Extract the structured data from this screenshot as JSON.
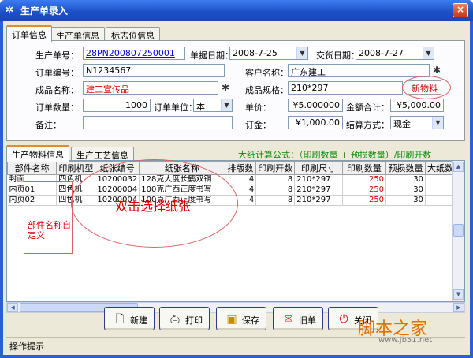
{
  "window": {
    "title": "生产单录入",
    "close_glyph": "×"
  },
  "tabs_top": [
    {
      "label": "订单信息"
    },
    {
      "label": "生产单信息"
    },
    {
      "label": "标志位信息"
    }
  ],
  "form": {
    "production_no_label": "生产单号：",
    "production_no_value": "28PN200807250001",
    "order_date_label": "单据日期：",
    "order_date_value": "2008-7-25",
    "delivery_date_label": "交货日期：",
    "delivery_date_value": "2008-7-27",
    "order_no_label": "订单编号：",
    "order_no_value": "N1234567",
    "customer_label": "客户名称：",
    "customer_value": "广东建工",
    "product_label": "成品名称：",
    "product_value": "建工宣传品",
    "spec_label": "成品规格：",
    "spec_value": "210*297",
    "new_material_label": "新物料",
    "quantity_label": "订单数量：",
    "quantity_value": "1000",
    "unit_label": "订单单位：",
    "unit_value": "本",
    "price_label": "单价：",
    "price_value": "¥5.000000",
    "total_label": "金额合计：",
    "total_value": "¥5,000.00",
    "remark_label": "备注：",
    "remark_value": "",
    "deposit_label": "订金：",
    "deposit_value": "¥1,000.00",
    "settle_label": "结算方式：",
    "settle_value": "现金"
  },
  "tabs_bottom": [
    {
      "label": "生产物料信息"
    },
    {
      "label": "生产工艺信息"
    }
  ],
  "formula": "大纸计算公式：（印刷数量 + 预损数量）/印刷开数",
  "grid": {
    "columns": [
      "部件名称",
      "印刷机型",
      "纸张编号",
      "纸张名称",
      "排版数",
      "印刷开数",
      "印刷尺寸",
      "印刷数量",
      "预损数量",
      "大纸数量"
    ],
    "rows": [
      [
        "封面",
        "四色机",
        "10200032",
        "128克大度长鹤双铜",
        "4",
        "8",
        "210*297",
        "250",
        "30",
        "35"
      ],
      [
        "内页01",
        "四色机",
        "10200004",
        "100克广西正度书写",
        "4",
        "8",
        "210*297",
        "250",
        "30",
        "35"
      ],
      [
        "内页02",
        "四色机",
        "10200004",
        "100克广西正度书写",
        "4",
        "8",
        "210*297",
        "250",
        "30",
        "35"
      ]
    ]
  },
  "annotations": {
    "part_name_note": "部件名称自定义",
    "double_click_note": "双击选择纸张"
  },
  "buttons": {
    "new": "新建",
    "print": "打印",
    "save": "保存",
    "old": "旧单",
    "close": "关闭"
  },
  "status": "操作提示",
  "watermark": {
    "brand": "脚本之家",
    "url": "www.jb51.net"
  }
}
